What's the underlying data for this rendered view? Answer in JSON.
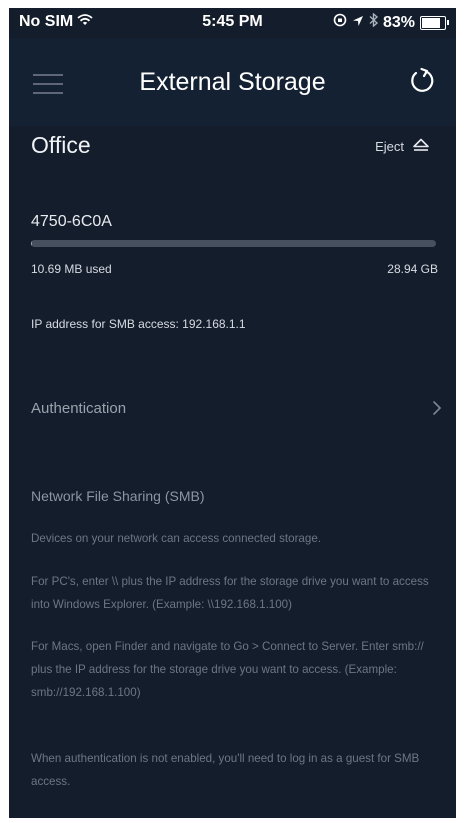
{
  "status_bar": {
    "carrier": "No SIM",
    "time": "5:45 PM",
    "battery": "83%",
    "battery_level": 0.83
  },
  "nav": {
    "title": "External Storage",
    "menu_icon": "hamburger-menu-icon",
    "refresh_icon": "refresh-icon"
  },
  "storage": {
    "section_name": "Office",
    "eject_label": "Eject",
    "drive_name": "4750-6C0A",
    "used_label": "10.69 MB used",
    "total_label": "28.94 GB",
    "used_fraction": 0.0004,
    "ip_line": "IP address for SMB access: 192.168.1.1"
  },
  "authentication": {
    "label": "Authentication"
  },
  "smb": {
    "title": "Network File Sharing (SMB)",
    "paragraphs": [
      "Devices on your network can access connected storage.",
      "For PC's, enter \\\\ plus the IP address for the storage drive you want to access into Windows Explorer. (Example: \\\\192.168.1.100)",
      "For Macs, open Finder and navigate to Go > Connect to Server. Enter smb:// plus the IP address for the storage drive you want to access. (Example: smb://192.168.1.100)",
      "When authentication is not enabled, you'll need to log in as a guest for SMB access."
    ]
  },
  "colors": {
    "background": "#141d2c",
    "navbar": "#142133",
    "bar_track": "#47505f",
    "bar_fill": "#9aa4b3"
  }
}
